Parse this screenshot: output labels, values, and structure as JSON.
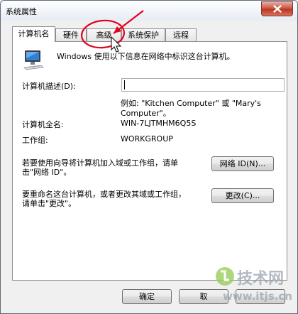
{
  "window": {
    "title": "系统属性"
  },
  "tabs": [
    {
      "label": "计算机名",
      "active": true
    },
    {
      "label": "硬件",
      "active": false
    },
    {
      "label": "高级",
      "active": false
    },
    {
      "label": "系统保护",
      "active": false
    },
    {
      "label": "远程",
      "active": false
    }
  ],
  "panel": {
    "intro": "Windows 使用以下信息在网络中标识这台计算机。",
    "description_label": "计算机描述(D):",
    "description_value": "",
    "example_line1": "例如: \"Kitchen Computer\" 或 \"Mary's",
    "example_line2": "Computer\"。",
    "fullname_label": "计算机全名:",
    "fullname_value": "WIN-7LJTMHM6Q5S",
    "workgroup_label": "工作组:",
    "workgroup_value": "WORKGROUP",
    "network_text_line1": "若要使用向导将计算机加入域或工作组，请单",
    "network_text_line2": "击\"网络 ID\"。",
    "network_button": "网络 ID(N)...",
    "rename_text_line1": "要重命名这台计算机，或者更改其域或工作组，",
    "rename_text_line2": "请单击\"更改\"。",
    "change_button": "更改(C)..."
  },
  "buttons": {
    "ok": "确定",
    "cancel": "取",
    "apply": ""
  },
  "watermark": {
    "brand": "技术网",
    "url": "www.itjs.cn"
  }
}
